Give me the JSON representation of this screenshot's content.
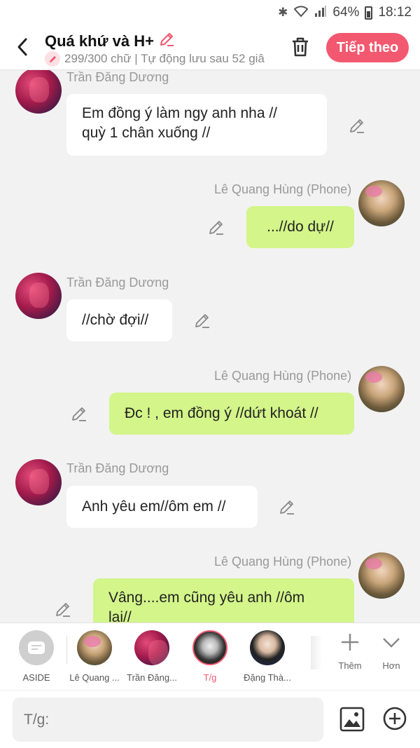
{
  "status_bar": {
    "battery": "64%",
    "time": "18:12",
    "icons": [
      "bluetooth-icon",
      "wifi-icon",
      "signal-icon",
      "battery-icon"
    ]
  },
  "header": {
    "title": "Quá khứ và H+",
    "subtitle": "299/300 chữ | Tự động lưu sau 52 giâ",
    "next_button": "Tiếp theo"
  },
  "messages": [
    {
      "side": "left",
      "sender": "Trần Đăng Dương",
      "text": "Em đồng ý làm ngy anh nha //\nquỳ 1 chân xuống //",
      "name_visible": true
    },
    {
      "side": "right",
      "sender": "Lê Quang Hùng (Phone)",
      "text": "...//do dự//"
    },
    {
      "side": "left",
      "sender": "Trần Đăng Dương",
      "text": "//chờ đợi//"
    },
    {
      "side": "right",
      "sender": "Lê Quang Hùng (Phone)",
      "text": "Đc ! , em đồng ý //dứt khoát //"
    },
    {
      "side": "left",
      "sender": "Trần Đăng Dương",
      "text": "Anh yêu em//ôm em //"
    },
    {
      "side": "right",
      "sender": "Lê Quang Hùng (Phone)",
      "text": "Vâng....em cũng yêu anh //ôm\nlại//"
    }
  ],
  "characters": [
    {
      "label": "ASIDE"
    },
    {
      "label": "Lê Quang ..."
    },
    {
      "label": "Trần Đăng..."
    },
    {
      "label": "T/g"
    },
    {
      "label": "Đặng Thà..."
    }
  ],
  "tools": {
    "add_label": "Thêm",
    "more_label": "Hơn"
  },
  "input": {
    "placeholder": "T/g:"
  },
  "colors": {
    "accent": "#f2586f",
    "right_bubble": "#d3f58a",
    "left_bubble": "#ffffff",
    "background": "#f2f2f2"
  }
}
